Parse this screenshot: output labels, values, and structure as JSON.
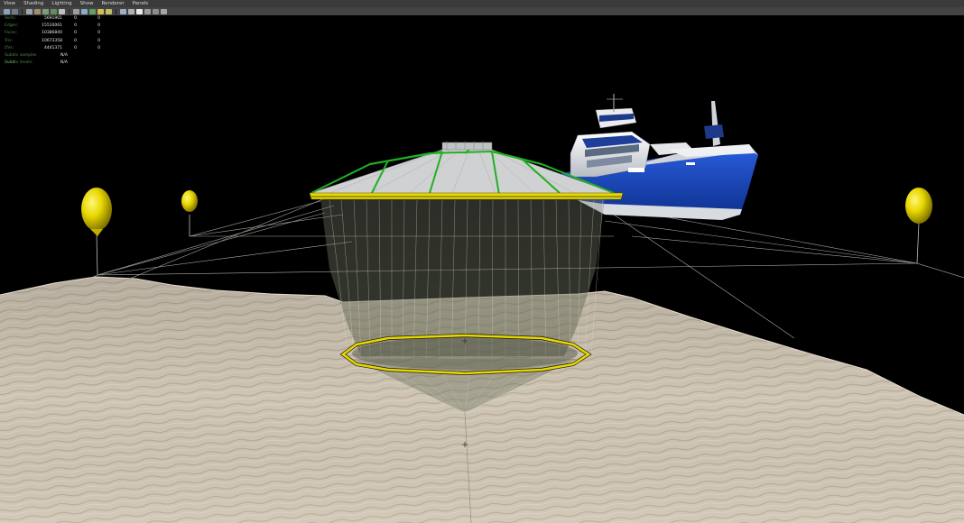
{
  "menu": [
    "View",
    "Shading",
    "Lighting",
    "Show",
    "Renderer",
    "Panels"
  ],
  "toolbar_icons": [
    "camera-icon",
    "frame-icon",
    "grid-icon",
    "film-gate-icon",
    "resolution-gate-icon",
    "gate-mask-icon",
    "safe-action-icon",
    "wireframe-icon",
    "smooth-shade-icon",
    "textured-icon",
    "lights-icon",
    "shadows-icon",
    "xray-icon",
    "isolate-icon",
    "hud-icon",
    "exposure-icon",
    "gamma-icon",
    "color-mgmt-icon"
  ],
  "colors": {
    "menubar": "#3b3b3b",
    "toolbar": "#444444",
    "hud_label": "#4a8a4a",
    "hud_value": "#e8e8e8",
    "sand": "#cfc5b4",
    "float_yellow": "#e8d800",
    "net_green": "#22b022",
    "hull_blue": "#1446c8"
  },
  "hud": {
    "rows": [
      {
        "label": "Verts:",
        "a": "5691901",
        "b": "0",
        "c": "0"
      },
      {
        "label": "Edges:",
        "a": "15510061",
        "b": "0",
        "c": "0"
      },
      {
        "label": "Faces:",
        "a": "10386840",
        "b": "0",
        "c": "0"
      },
      {
        "label": "Tris:",
        "a": "10673358",
        "b": "0",
        "c": "0"
      },
      {
        "label": "UVs:",
        "a": "4441371",
        "b": "0",
        "c": "0"
      }
    ],
    "extra": [
      {
        "label": "Subdiv samples (lvls):",
        "value": "N/A"
      },
      {
        "label": "Subdiv levels:",
        "value": "N/A"
      }
    ]
  }
}
